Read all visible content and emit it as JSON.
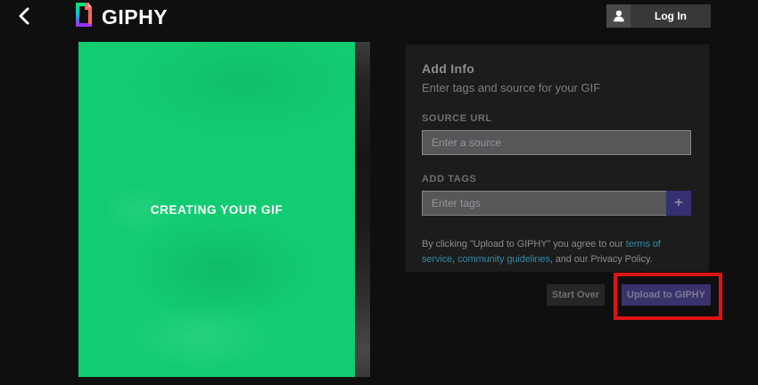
{
  "header": {
    "logo_text": "GIPHY",
    "login_label": "Log In"
  },
  "media": {
    "status_label": "CREATING YOUR GIF"
  },
  "panel": {
    "title": "Add Info",
    "subtitle": "Enter tags and source for your GIF",
    "source": {
      "label": "SOURCE URL",
      "placeholder": "Enter a source",
      "value": ""
    },
    "tags": {
      "label": "ADD TAGS",
      "placeholder": "Enter tags",
      "value": "",
      "add_button_label": "+"
    },
    "terms": {
      "part1": "By clicking \"Upload to GIPHY\" you agree to our ",
      "link_terms": "terms of service",
      "part2": ", ",
      "link_guidelines": "community guidelines",
      "part3": ", and our Privacy Policy."
    }
  },
  "actions": {
    "start_over_label": "Start Over",
    "upload_label": "Upload to GIPHY"
  },
  "annotation": {
    "type": "highlight-box",
    "target": "upload-to-giphy-button",
    "color": "#df1313"
  },
  "colors": {
    "page_background": "#0f0f0f",
    "panel_background": "#1c1c1c",
    "preview_green": "#12cc71",
    "tag_add_indigo": "#353071",
    "upload_button_indigo": "#39336b",
    "link_teal": "#2f8ba3",
    "annotation_red": "#df1313"
  }
}
